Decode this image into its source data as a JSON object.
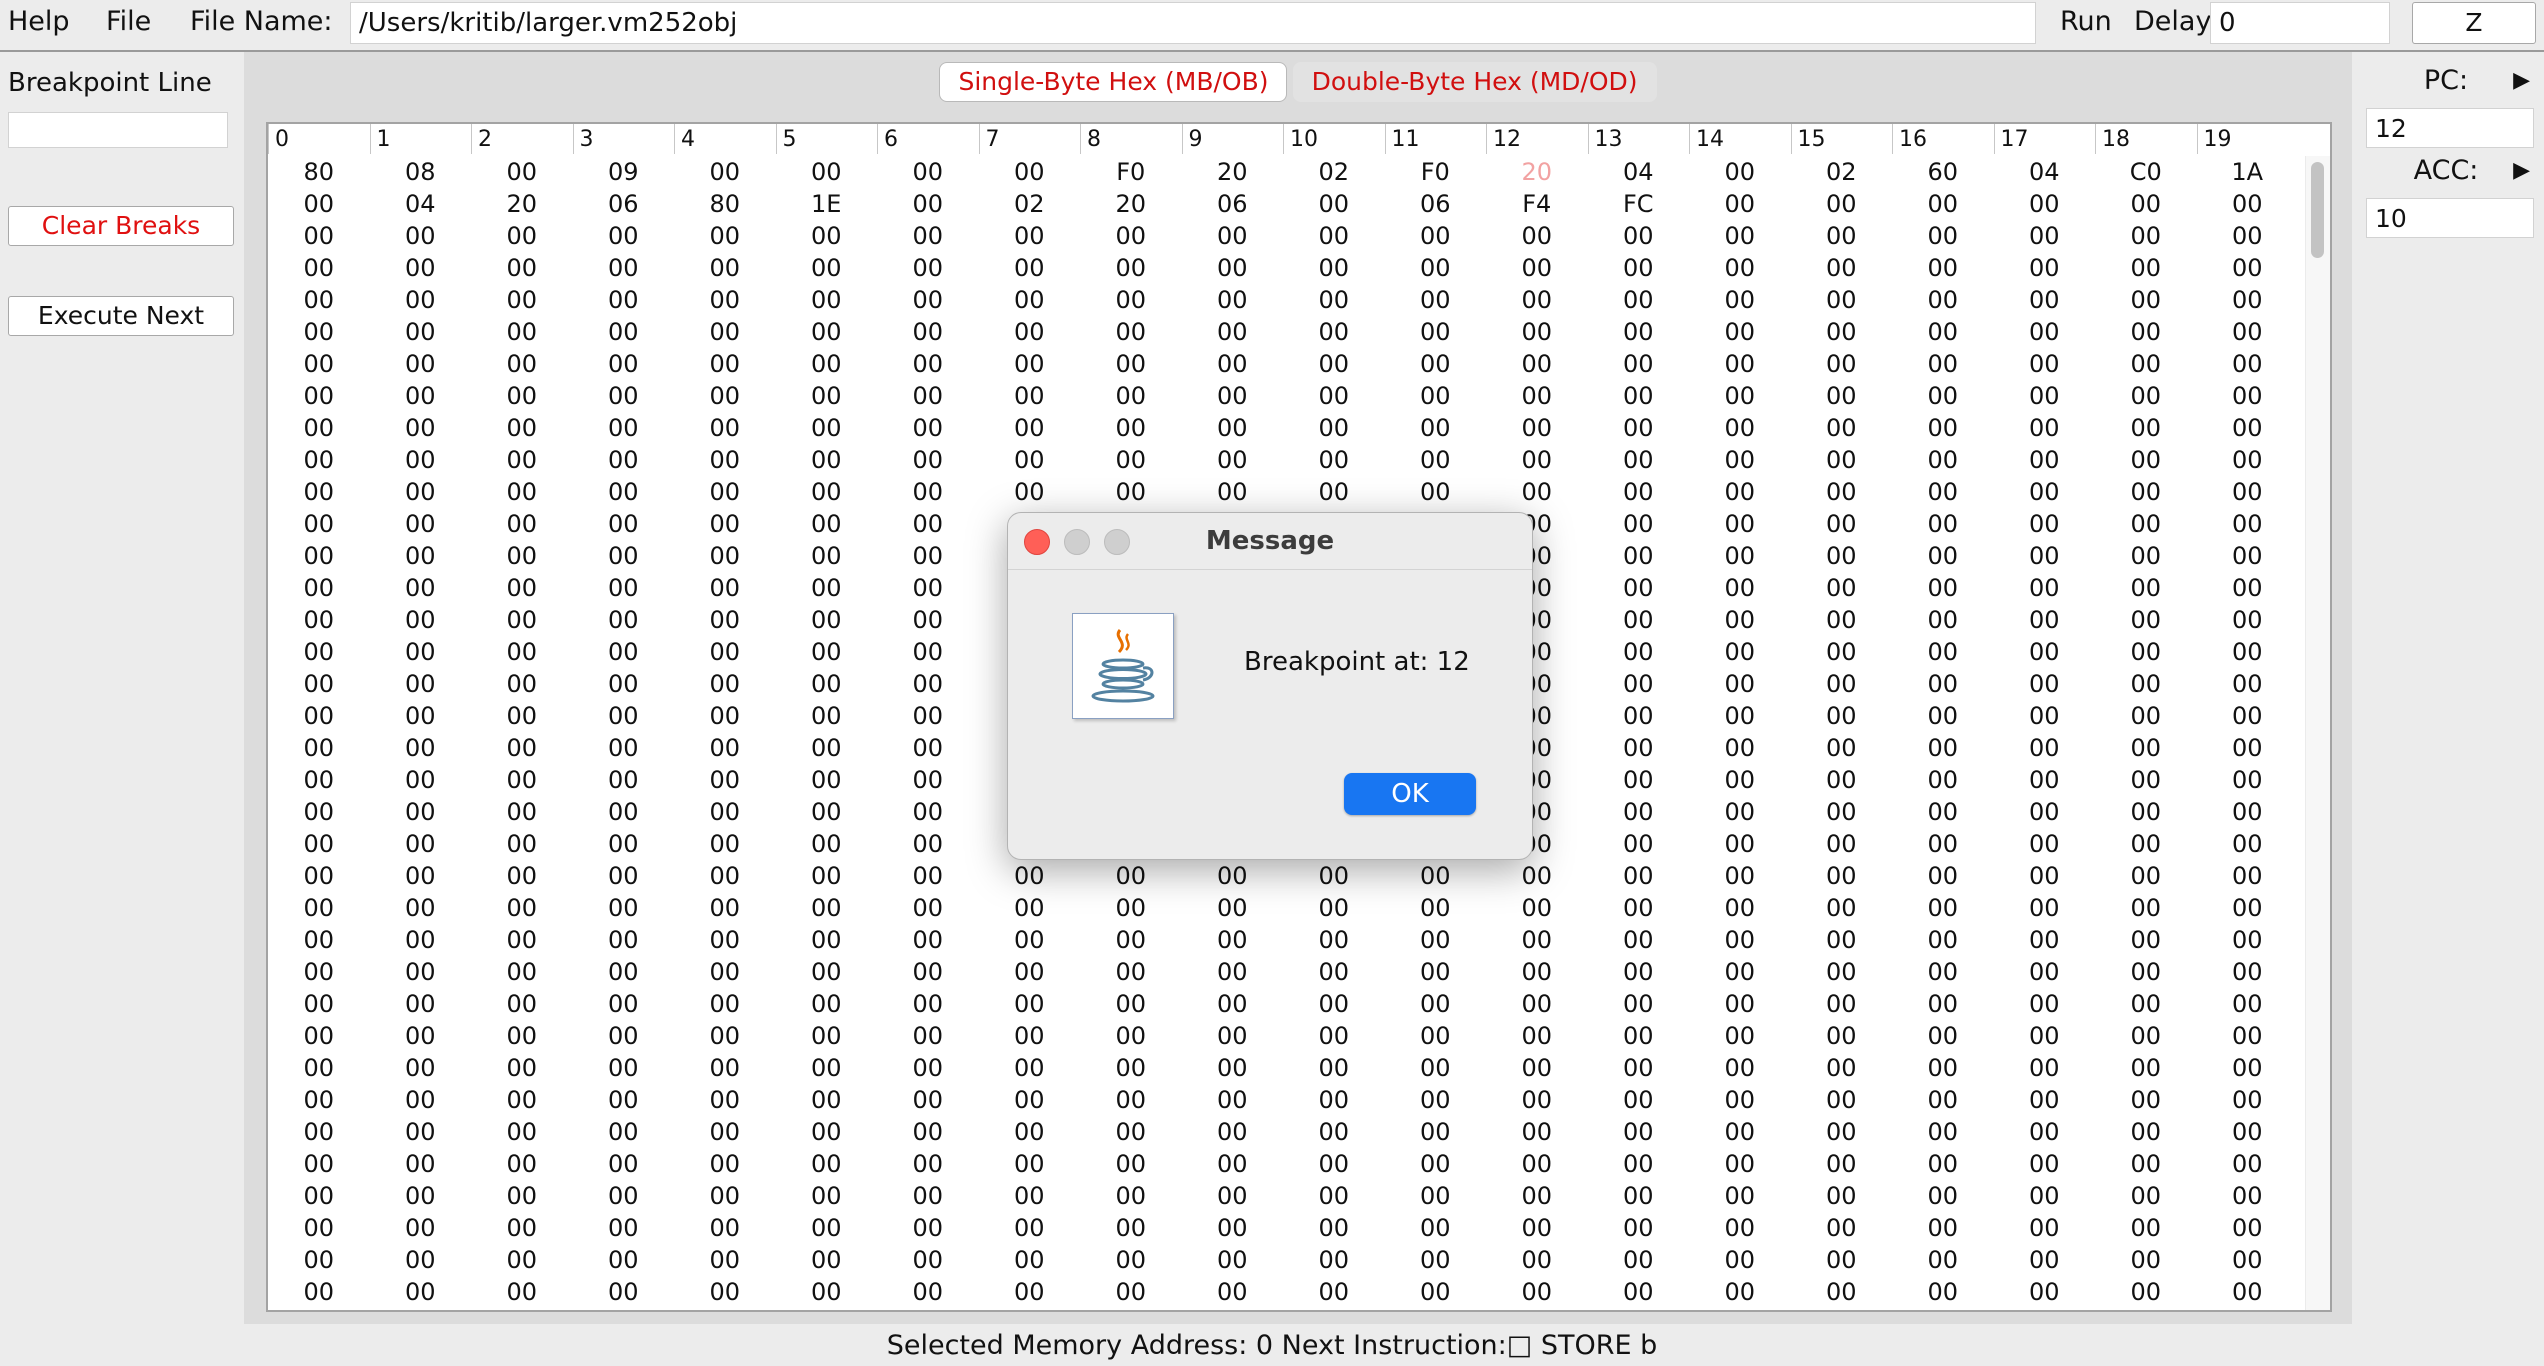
{
  "menu": {
    "help": "Help",
    "file": "File"
  },
  "toolbar": {
    "file_name_label": "File Name:",
    "file_name_value": "/Users/kritib/larger.vm252obj",
    "run_label": "Run",
    "delay_label": "Delay:",
    "delay_value": "0",
    "z_button": "Z"
  },
  "left": {
    "breakpoint_label": "Breakpoint Line ...",
    "breakpoint_value": "",
    "clear_breaks": "Clear Breaks",
    "execute_next": "Execute Next"
  },
  "right": {
    "pc_label": "PC:",
    "pc_value": "12",
    "acc_label": "ACC:",
    "acc_value": "10",
    "arrow": "▶"
  },
  "tabs": {
    "single": "Single-Byte Hex (MB/OB)",
    "double": "Double-Byte Hex (MD/OD)"
  },
  "table": {
    "columns": [
      "0",
      "1",
      "2",
      "3",
      "4",
      "5",
      "6",
      "7",
      "8",
      "9",
      "10",
      "11",
      "12",
      "13",
      "14",
      "15",
      "16",
      "17",
      "18",
      "19"
    ],
    "row0": [
      "80",
      "08",
      "00",
      "09",
      "00",
      "00",
      "00",
      "00",
      "F0",
      "20",
      "02",
      "F0",
      "20",
      "04",
      "00",
      "02",
      "60",
      "04",
      "C0",
      "1A"
    ],
    "row1": [
      "00",
      "04",
      "20",
      "06",
      "80",
      "1E",
      "00",
      "02",
      "20",
      "06",
      "00",
      "06",
      "F4",
      "FC",
      "00",
      "00",
      "00",
      "00",
      "00",
      "00"
    ],
    "fill_value": "00",
    "highlight_row": 0,
    "highlight_col": 12,
    "visible_rows": 36
  },
  "status": {
    "text": "Selected Memory Address: 0 Next Instruction:□ STORE b"
  },
  "dialog": {
    "title": "Message",
    "message": "Breakpoint at: 12",
    "ok": "OK"
  },
  "colors": {
    "accent_red": "#d10f0f",
    "highlight_cell": "#f2a2a2",
    "ok_blue": "#1876f2",
    "close_red": "#ff5f57",
    "traffic_grey": "#c9c9c9"
  }
}
